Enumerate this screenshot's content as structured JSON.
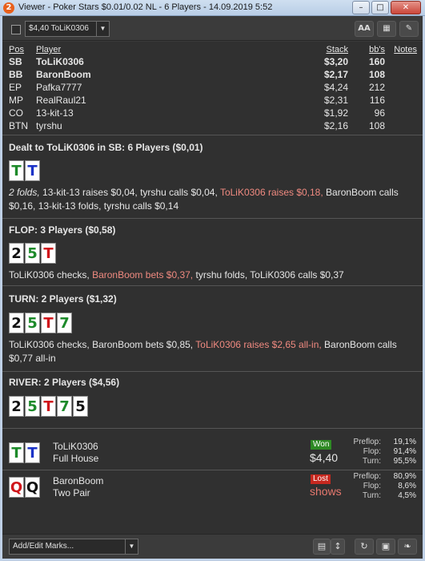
{
  "window": {
    "app_icon": "2",
    "title": "Viewer - Poker Stars $0.01/0.02 NL - 6 Players - 14.09.2019 5:52",
    "min": "–",
    "max": "□",
    "close": "✕"
  },
  "toolbar": {
    "hand_select": "$4,40 ToLiK0306",
    "font_button": "AA",
    "grid_button": "▦",
    "edit_button": "✎"
  },
  "table": {
    "headers": {
      "pos": "Pos",
      "player": "Player",
      "stack": "Stack",
      "bbs": "bb's",
      "notes": "Notes"
    },
    "rows": [
      {
        "pos": "SB",
        "player": "ToLiK0306",
        "stack": "$3,20",
        "bbs": "160",
        "bold": true
      },
      {
        "pos": "BB",
        "player": "BaronBoom",
        "stack": "$2,17",
        "bbs": "108",
        "bold": true
      },
      {
        "pos": "EP",
        "player": "Pafka7777",
        "stack": "$4,24",
        "bbs": "212"
      },
      {
        "pos": "MP",
        "player": "RealRaul21",
        "stack": "$2,31",
        "bbs": "116"
      },
      {
        "pos": "CO",
        "player": "13-kit-13",
        "stack": "$1,92",
        "bbs": "96"
      },
      {
        "pos": "BTN",
        "player": "tyrshu",
        "stack": "$2,16",
        "bbs": "108"
      }
    ]
  },
  "preflop": {
    "title": "Dealt to ToLiK0306 in SB: 6 Players ($0,01)",
    "cards": [
      {
        "r": "T",
        "s": "c"
      },
      {
        "r": "T",
        "s": "d"
      }
    ],
    "a1": "2 folds,",
    "a2": " 13-kit-13 raises $0,04, tyrshu calls $0,04, ",
    "a3": "ToLiK0306 raises $0,18,",
    "a4": " BaronBoom calls $0,16, 13-kit-13 folds, tyrshu calls $0,14"
  },
  "flop": {
    "title": "FLOP: 3 Players ($0,58)",
    "cards": [
      {
        "r": "2",
        "s": "s"
      },
      {
        "r": "5",
        "s": "c"
      },
      {
        "r": "T",
        "s": "h"
      }
    ],
    "a1": "ToLiK0306 checks, ",
    "a2": "BaronBoom bets $0,37,",
    "a3": " tyrshu folds, ToLiK0306 calls $0,37"
  },
  "turn": {
    "title": "TURN: 2 Players ($1,32)",
    "cards": [
      {
        "r": "2",
        "s": "s"
      },
      {
        "r": "5",
        "s": "c"
      },
      {
        "r": "T",
        "s": "h"
      },
      {
        "r": "7",
        "s": "c"
      }
    ],
    "a1": "ToLiK0306 checks, BaronBoom bets $0,85, ",
    "a2": "ToLiK0306 raises $2,65 all-in,",
    "a3": " BaronBoom calls $0,77 all-in"
  },
  "river": {
    "title": "RIVER: 2 Players ($4,56)",
    "cards": [
      {
        "r": "2",
        "s": "s"
      },
      {
        "r": "5",
        "s": "c"
      },
      {
        "r": "T",
        "s": "h"
      },
      {
        "r": "7",
        "s": "c"
      },
      {
        "r": "5",
        "s": "s"
      }
    ]
  },
  "results": [
    {
      "cards": [
        {
          "r": "T",
          "s": "c"
        },
        {
          "r": "T",
          "s": "d"
        }
      ],
      "name": "ToLiK0306",
      "hand": "Full House",
      "badge": "Won",
      "amount": "$4,40",
      "eq": [
        {
          "l": "Preflop:",
          "v": "19,1%"
        },
        {
          "l": "Flop:",
          "v": "91,4%"
        },
        {
          "l": "Turn:",
          "v": "95,5%"
        }
      ]
    },
    {
      "cards": [
        {
          "r": "Q",
          "s": "h"
        },
        {
          "r": "Q",
          "s": "s"
        }
      ],
      "name": "BaronBoom",
      "hand": "Two Pair",
      "badge": "Lost",
      "amount": "shows",
      "eq": [
        {
          "l": "Preflop:",
          "v": "80,9%"
        },
        {
          "l": "Flop:",
          "v": "8,6%"
        },
        {
          "l": "Turn:",
          "v": "4,5%"
        }
      ]
    }
  ],
  "bottombar": {
    "marks": "Add/Edit Marks...",
    "calc_icon": "▤",
    "updown_icon": "↕",
    "refresh_icon": "↻",
    "save_icon": "▣",
    "twitter_icon": "❧"
  },
  "colors": {
    "clubs": "#1d8a2a",
    "spades": "#111111",
    "hearts": "#d0161b",
    "diamonds": "#1b33c7",
    "highlight": "#f08a80",
    "won": "#2e8a24",
    "lost": "#c6281f"
  }
}
